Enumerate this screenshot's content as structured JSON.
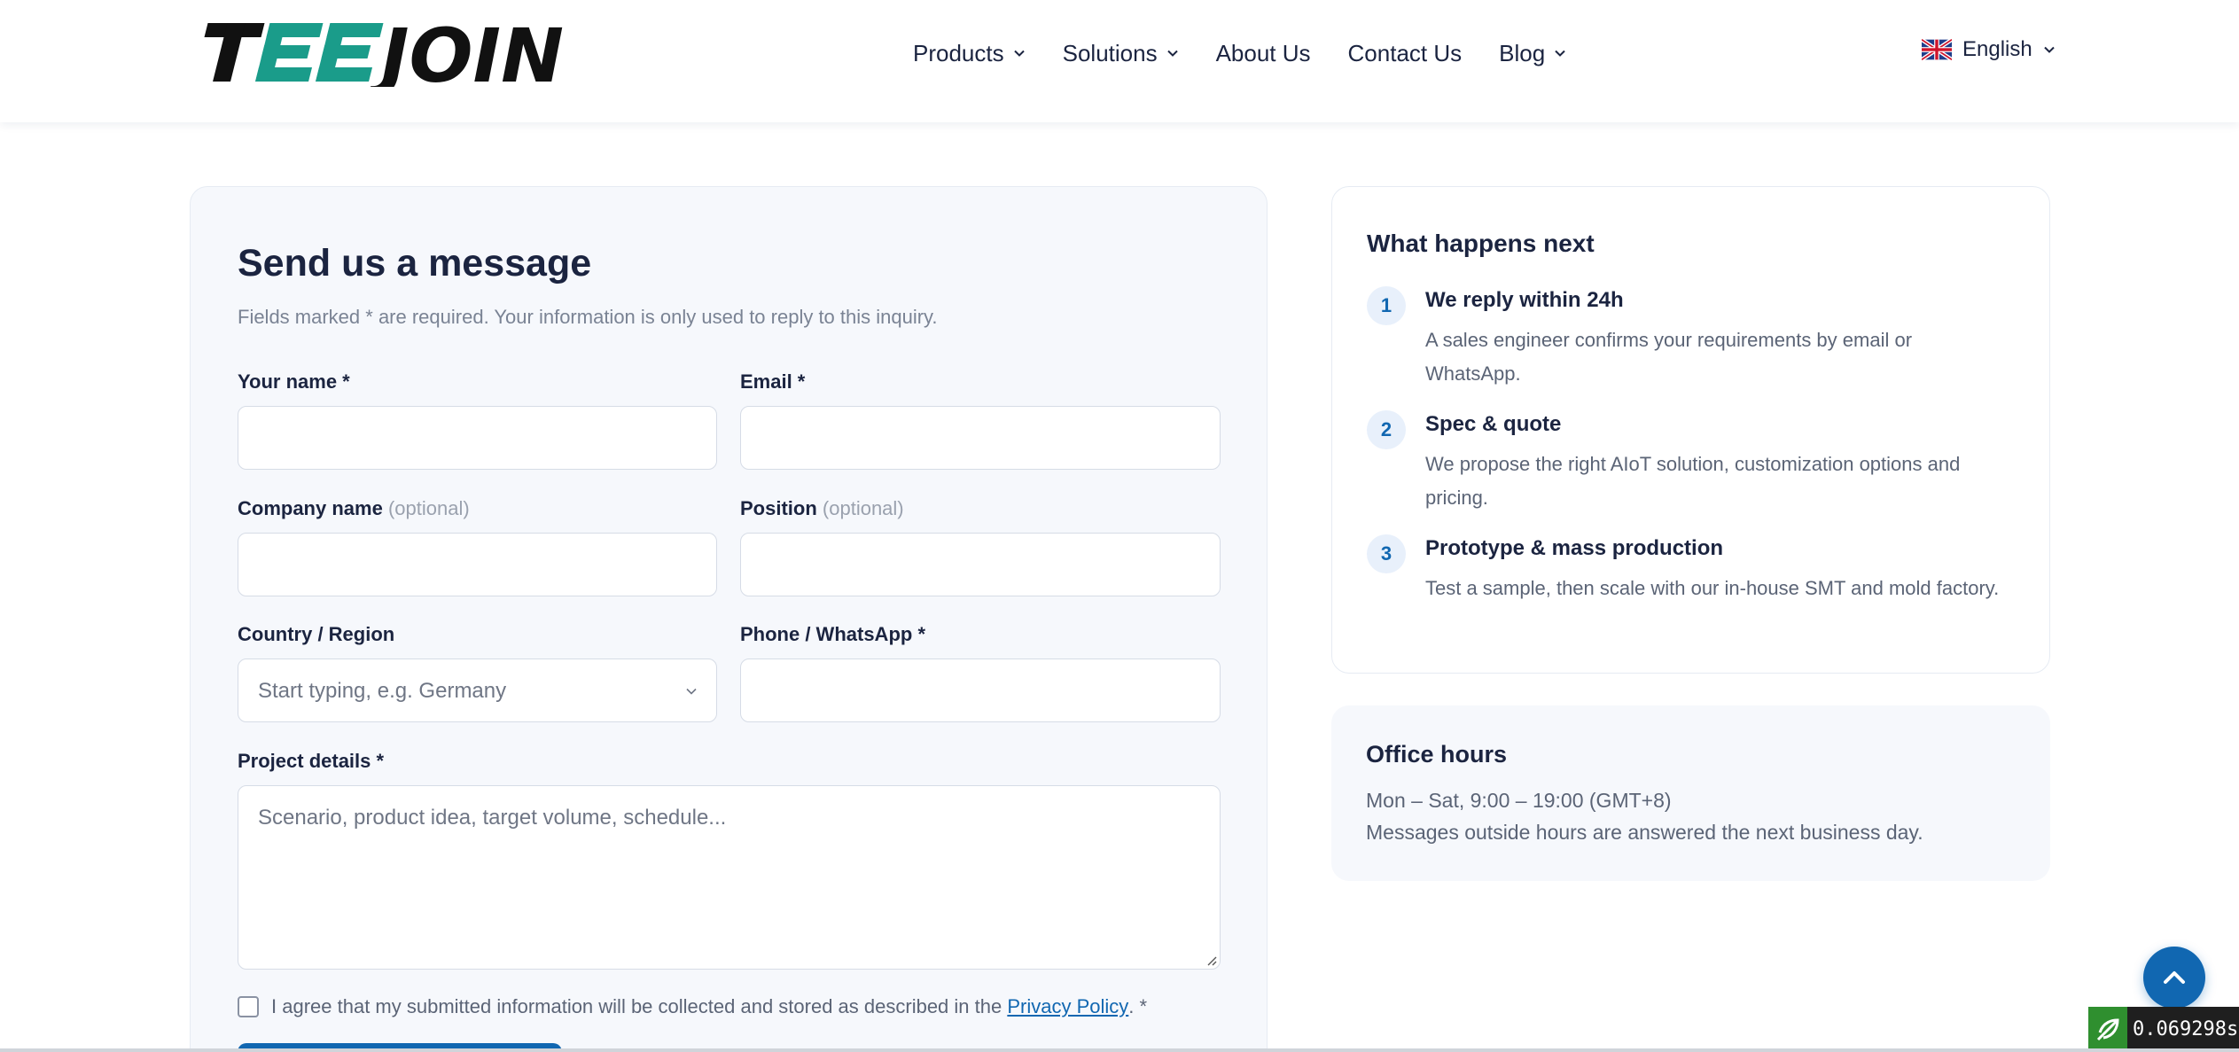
{
  "header": {
    "logo_text": "TEEJOIN",
    "nav": [
      {
        "label": "Products",
        "has_dropdown": true
      },
      {
        "label": "Solutions",
        "has_dropdown": true
      },
      {
        "label": "About Us",
        "has_dropdown": false
      },
      {
        "label": "Contact Us",
        "has_dropdown": false
      },
      {
        "label": "Blog",
        "has_dropdown": true
      }
    ],
    "language": {
      "label": "English",
      "flag_icon": "uk-flag-icon"
    }
  },
  "form": {
    "title": "Send us a message",
    "subtitle": "Fields marked * are required. Your information is only used to reply to this inquiry.",
    "fields": {
      "name": {
        "label": "Your name *",
        "value": ""
      },
      "email": {
        "label": "Email *",
        "value": ""
      },
      "company": {
        "label": "Company name",
        "optional": "(optional)",
        "value": ""
      },
      "position": {
        "label": "Position",
        "optional": "(optional)",
        "value": ""
      },
      "country": {
        "label": "Country / Region",
        "placeholder": "Start typing, e.g. Germany"
      },
      "phone": {
        "label": "Phone / WhatsApp *",
        "value": ""
      },
      "project": {
        "label": "Project details *",
        "placeholder": "Scenario, product idea, target volume, schedule..."
      }
    },
    "agree": {
      "text": "I agree that my submitted information will be collected and stored as described in the",
      "link": "Privacy Policy",
      "suffix": ". *",
      "checked": false
    }
  },
  "next": {
    "title": "What happens next",
    "steps": [
      {
        "num": "1",
        "title": "We reply within 24h",
        "desc": "A sales engineer confirms your requirements by email or WhatsApp."
      },
      {
        "num": "2",
        "title": "Spec & quote",
        "desc": "We propose the right AIoT solution, customization options and pricing."
      },
      {
        "num": "3",
        "title": "Prototype & mass production",
        "desc": "Test a sample, then scale with our in-house SMT and mold factory."
      }
    ]
  },
  "hours": {
    "title": "Office hours",
    "line1": "Mon – Sat, 9:00 – 19:00 (GMT+8)",
    "line2": "Messages outside hours are answered the next business day."
  },
  "perf_badge": "0.069298s",
  "colors": {
    "accent": "#1167b1",
    "logo_teal": "#1a9c8a",
    "text_dark": "#1b2440"
  }
}
